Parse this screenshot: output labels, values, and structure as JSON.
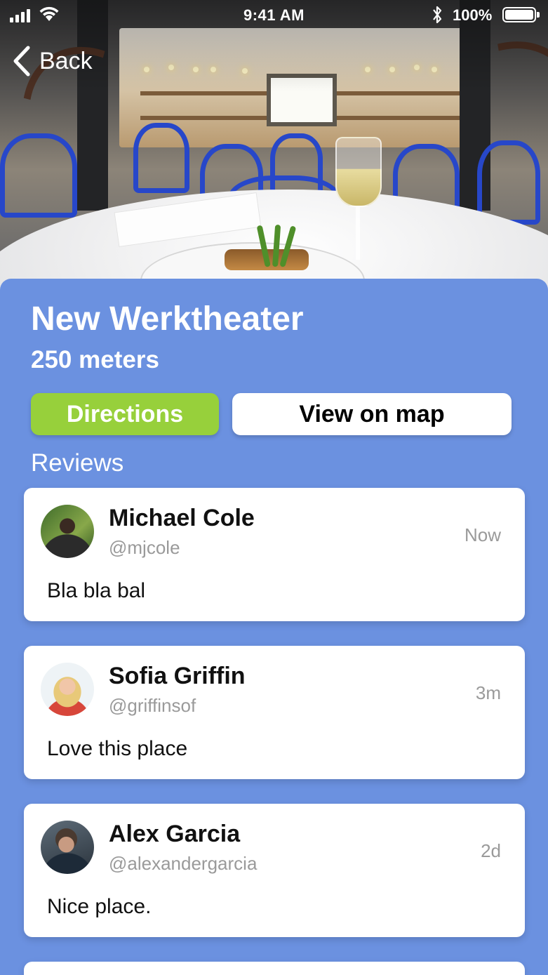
{
  "status_bar": {
    "time": "9:41 AM",
    "battery_percent": "100%",
    "icons": [
      "signal-icon",
      "wifi-icon",
      "bluetooth-icon",
      "battery-icon"
    ]
  },
  "nav": {
    "back_label": "Back",
    "back_icon": "chevron-left-icon"
  },
  "venue": {
    "name": "New Werktheater",
    "distance": "250 meters"
  },
  "actions": {
    "directions_label": "Directions",
    "map_label": "View on map"
  },
  "reviews": {
    "label": "Reviews",
    "items": [
      {
        "name": "Michael Cole",
        "handle": "@mjcole",
        "time": "Now",
        "text": "Bla bla bal"
      },
      {
        "name": "Sofia Griffin",
        "handle": "@griffinsof",
        "time": "3m",
        "text": "Love this place"
      },
      {
        "name": "Alex Garcia",
        "handle": "@alexandergarcia",
        "time": "2d",
        "text": "Nice place."
      }
    ]
  },
  "colors": {
    "panel": "#6b91e0",
    "directions_button": "#97d03b",
    "map_button": "#ffffff"
  }
}
